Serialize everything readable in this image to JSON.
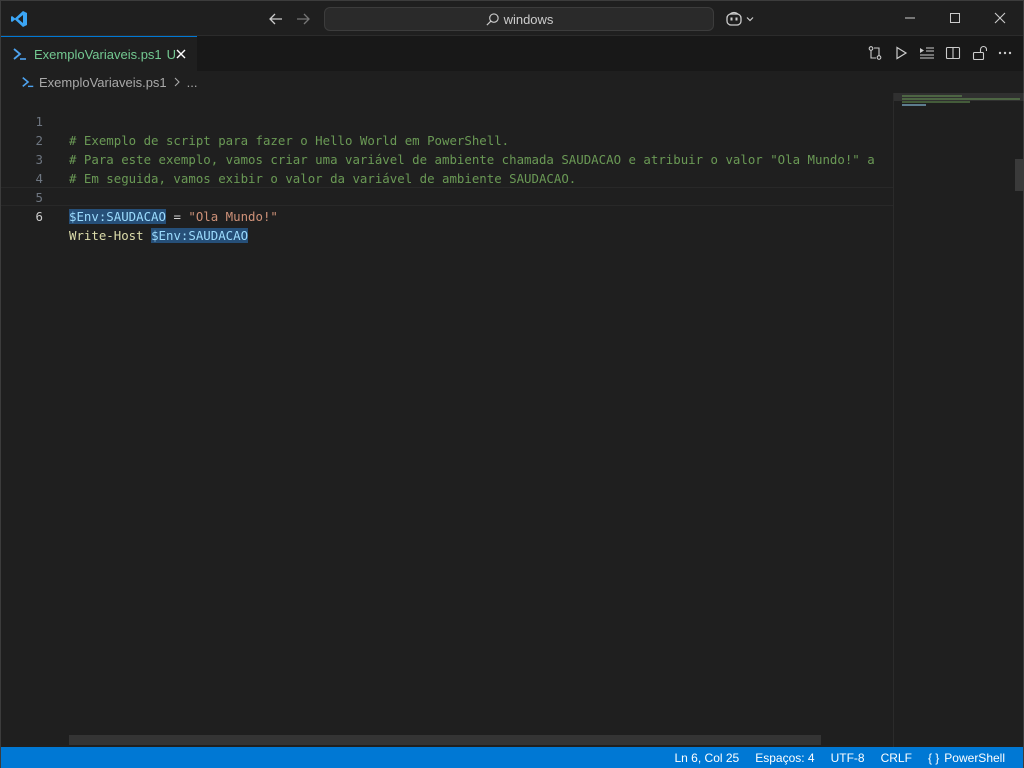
{
  "titlebar": {
    "search_text": "windows"
  },
  "tab": {
    "filename": "ExemploVariaveis.ps1",
    "status": "U"
  },
  "breadcrumb": {
    "file": "ExemploVariaveis.ps1",
    "more": "..."
  },
  "editor": {
    "lines": [
      {
        "number": "1",
        "text": "# Exemplo de script para fazer o Hello World em PowerShell."
      },
      {
        "number": "2",
        "text": "# Para este exemplo, vamos criar uma variável de ambiente chamada SAUDACAO e atribuir o valor \"Ola Mundo!\" a"
      },
      {
        "number": "3",
        "text": "# Em seguida, vamos exibir o valor da variável de ambiente SAUDACAO."
      },
      {
        "number": "4",
        "text": ""
      },
      {
        "number": "5",
        "var": "$Env:SAUDACAO",
        "op": " = ",
        "str": "\"Ola Mundo!\""
      },
      {
        "number": "6",
        "cmd": "Write-Host",
        "space": " ",
        "var": "$Env:SAUDACAO"
      }
    ]
  },
  "statusbar": {
    "position": "Ln 6, Col 25",
    "indent": "Espaços: 4",
    "encoding": "UTF-8",
    "eol": "CRLF",
    "language_brace": "{ }",
    "language": "PowerShell"
  },
  "colors": {
    "accent": "#0078d4",
    "comment": "#6a9955",
    "variable": "#9cdcfe",
    "string": "#ce9178",
    "command": "#dcdcaa",
    "untracked": "#73c991"
  },
  "icons": [
    "vscode-logo-icon",
    "arrow-left-icon",
    "arrow-right-icon",
    "search-icon",
    "copilot-icon",
    "chevron-down-icon",
    "minimize-icon",
    "maximize-icon",
    "close-icon",
    "powershell-icon",
    "compare-changes-icon",
    "run-icon",
    "run-selection-icon",
    "split-editor-icon",
    "unlock-icon",
    "more-actions-icon",
    "chevron-right-icon"
  ]
}
